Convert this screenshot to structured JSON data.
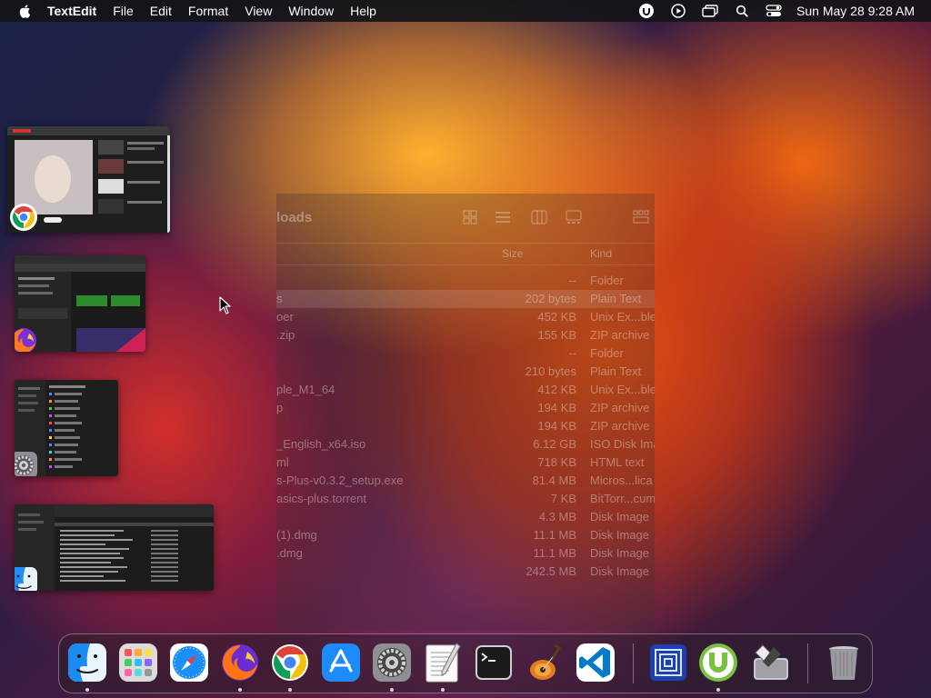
{
  "menubar": {
    "app_name": "TextEdit",
    "items": [
      "File",
      "Edit",
      "Format",
      "View",
      "Window",
      "Help"
    ],
    "clock": "Sun May 28  9:28 AM"
  },
  "finder": {
    "title": "loads",
    "columns": {
      "size": "Size",
      "kind": "Kind"
    },
    "rows": [
      {
        "name": "",
        "size": "--",
        "kind": "Folder"
      },
      {
        "name": "s",
        "size": "202 bytes",
        "kind": "Plain Text"
      },
      {
        "name": "oer",
        "size": "452 KB",
        "kind": "Unix Ex...ble"
      },
      {
        "name": ".zip",
        "size": "155 KB",
        "kind": "ZIP archive"
      },
      {
        "name": "",
        "size": "--",
        "kind": "Folder"
      },
      {
        "name": "",
        "size": "210 bytes",
        "kind": "Plain Text"
      },
      {
        "name": "ple_M1_64",
        "size": "412 KB",
        "kind": "Unix Ex...ble"
      },
      {
        "name": "p",
        "size": "194 KB",
        "kind": "ZIP archive"
      },
      {
        "name": "",
        "size": "194 KB",
        "kind": "ZIP archive"
      },
      {
        "name": "_English_x64.iso",
        "size": "6.12 GB",
        "kind": "ISO Disk Ima"
      },
      {
        "name": "ml",
        "size": "718 KB",
        "kind": "HTML text"
      },
      {
        "name": "s-Plus-v0.3.2_setup.exe",
        "size": "81.4 MB",
        "kind": "Micros...lica"
      },
      {
        "name": "asics-plus.torrent",
        "size": "7 KB",
        "kind": "BitTorr...cum"
      },
      {
        "name": "",
        "size": "4.3 MB",
        "kind": "Disk Image"
      },
      {
        "name": "(1).dmg",
        "size": "11.1 MB",
        "kind": "Disk Image"
      },
      {
        "name": ".dmg",
        "size": "11.1 MB",
        "kind": "Disk Image"
      },
      {
        "name": "",
        "size": "242.5 MB",
        "kind": "Disk Image"
      }
    ]
  },
  "thumbnails": [
    {
      "app": "chrome-icon"
    },
    {
      "app": "firefox-icon"
    },
    {
      "app": "system-settings-icon"
    },
    {
      "app": "finder-icon"
    }
  ],
  "dock": {
    "items": [
      {
        "name": "finder-icon",
        "running": true
      },
      {
        "name": "launchpad-icon",
        "running": false
      },
      {
        "name": "safari-icon",
        "running": false
      },
      {
        "name": "firefox-icon",
        "running": true
      },
      {
        "name": "chrome-icon",
        "running": true
      },
      {
        "name": "app-store-icon",
        "running": false
      },
      {
        "name": "system-settings-icon",
        "running": true
      },
      {
        "name": "textedit-icon",
        "running": true
      },
      {
        "name": "terminal-icon",
        "running": false
      },
      {
        "name": "garageband-icon",
        "running": false
      },
      {
        "name": "vscode-icon",
        "running": false
      },
      {
        "name": "blue-square-app-icon",
        "running": false
      },
      {
        "name": "utorrent-icon",
        "running": true
      },
      {
        "name": "disk-utility-icon",
        "running": false
      },
      {
        "name": "trash-icon",
        "running": false
      }
    ]
  },
  "colors": {
    "menubar_bg": "#141418",
    "chrome_red": "#db4437",
    "chrome_yellow": "#f4c20d",
    "chrome_green": "#0f9d58",
    "chrome_blue": "#4285f4",
    "utorrent_green": "#7ac143",
    "vscode_blue": "#007acc"
  }
}
